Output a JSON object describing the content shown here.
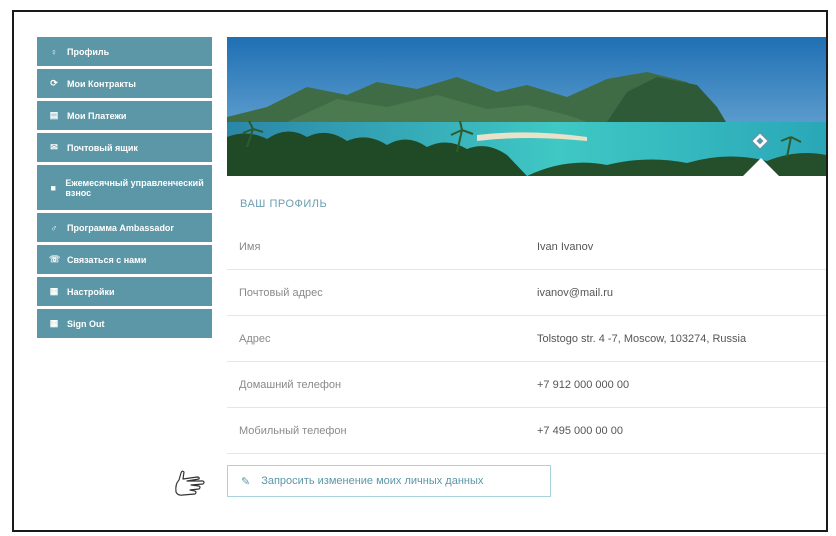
{
  "sidebar": {
    "items": [
      {
        "label": "Профиль",
        "icon": "person-icon",
        "symbol": "♀"
      },
      {
        "label": "Мои Контракты",
        "icon": "contracts-icon",
        "symbol": "⟳"
      },
      {
        "label": "Мои Платежи",
        "icon": "payments-icon",
        "symbol": "▤"
      },
      {
        "label": "Почтовый ящик",
        "icon": "mailbox-icon",
        "symbol": "✉"
      },
      {
        "label": "Ежемесячный управленческий взнос",
        "icon": "document-icon",
        "symbol": "■"
      },
      {
        "label": "Программа Ambassador",
        "icon": "ambassador-icon",
        "symbol": "♂"
      },
      {
        "label": "Связаться с нами",
        "icon": "contact-icon",
        "symbol": "☏"
      },
      {
        "label": "Настройки",
        "icon": "settings-icon",
        "symbol": "▦"
      },
      {
        "label": "Sign Out",
        "icon": "sign-out-icon",
        "symbol": "▦"
      }
    ]
  },
  "profile": {
    "title": "ВАШ ПРОФИЛЬ",
    "rows": [
      {
        "label": "Имя",
        "value": "Ivan Ivanov"
      },
      {
        "label": "Почтовый адрес",
        "value": "ivanov@mail.ru"
      },
      {
        "label": "Адрес",
        "value": "Tolstogo str. 4 -7, Moscow, 103274, Russia"
      },
      {
        "label": "Домашний телефон",
        "value": "+7 912 000 000 00"
      },
      {
        "label": "Мобильный телефон",
        "value": "+7 495 000 00 00"
      }
    ],
    "request_button": "Запросить изменение моих личных данных"
  },
  "colors": {
    "sidebar_bg": "#5c97a7",
    "accent": "#6a9fb0",
    "border": "#a9d2dc"
  }
}
